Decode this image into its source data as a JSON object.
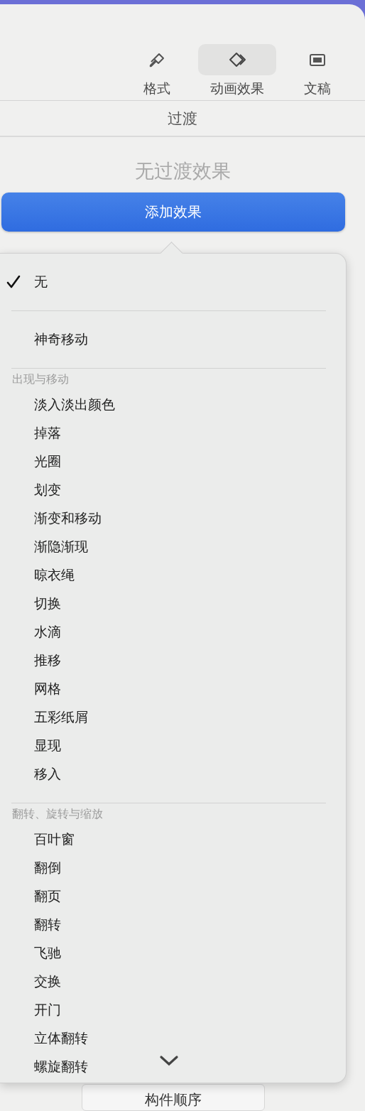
{
  "toolbar": {
    "tabs": [
      {
        "label": "格式",
        "selected": false
      },
      {
        "label": "动画效果",
        "selected": true
      },
      {
        "label": "文稿",
        "selected": false
      }
    ]
  },
  "section_tab": "过渡",
  "status": "无过渡效果",
  "add_button": "添加效果",
  "menu": {
    "sections": [
      {
        "items": [
          {
            "label": "无",
            "checked": true
          }
        ]
      },
      {
        "items": [
          {
            "label": "神奇移动",
            "checked": false
          }
        ]
      },
      {
        "header": "出现与移动",
        "items": [
          {
            "label": "淡入淡出颜色",
            "checked": false
          },
          {
            "label": "掉落",
            "checked": false
          },
          {
            "label": "光圈",
            "checked": false
          },
          {
            "label": "划变",
            "checked": false
          },
          {
            "label": "渐变和移动",
            "checked": false
          },
          {
            "label": "渐隐渐现",
            "checked": false
          },
          {
            "label": "晾衣绳",
            "checked": false
          },
          {
            "label": "切换",
            "checked": false
          },
          {
            "label": "水滴",
            "checked": false
          },
          {
            "label": "推移",
            "checked": false
          },
          {
            "label": "网格",
            "checked": false
          },
          {
            "label": "五彩纸屑",
            "checked": false
          },
          {
            "label": "显现",
            "checked": false
          },
          {
            "label": "移入",
            "checked": false
          }
        ]
      },
      {
        "header": "翻转、旋转与缩放",
        "items": [
          {
            "label": "百叶窗",
            "checked": false
          },
          {
            "label": "翻倒",
            "checked": false
          },
          {
            "label": "翻页",
            "checked": false
          },
          {
            "label": "翻转",
            "checked": false
          },
          {
            "label": "飞驰",
            "checked": false
          },
          {
            "label": "交换",
            "checked": false
          },
          {
            "label": "开门",
            "checked": false
          },
          {
            "label": "立体翻转",
            "checked": false
          },
          {
            "label": "螺旋翻转",
            "checked": false
          }
        ]
      }
    ]
  },
  "bottom_button": "构件顺序"
}
